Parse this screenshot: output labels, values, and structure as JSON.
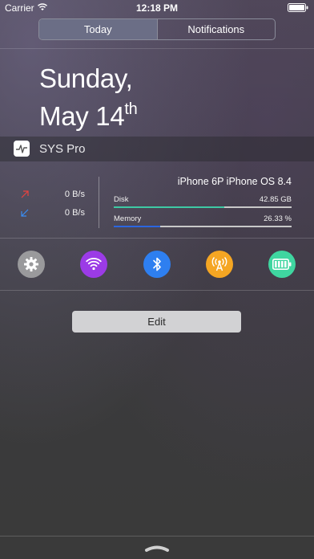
{
  "status_bar": {
    "carrier": "Carrier",
    "time": "12:18 PM"
  },
  "segments": [
    {
      "label": "Today",
      "selected": true
    },
    {
      "label": "Notifications",
      "selected": false
    }
  ],
  "date": {
    "weekday": "Sunday,",
    "month_day": "May 14",
    "suffix": "th"
  },
  "widget": {
    "title": "SYS Pro",
    "icon": "pulse-icon",
    "network": [
      {
        "direction": "upload",
        "icon": "arrow-up-right-icon",
        "color": "#e8433f",
        "value": "0 B/s"
      },
      {
        "direction": "download",
        "icon": "arrow-down-left-icon",
        "color": "#3a8ef5",
        "value": "0 B/s"
      }
    ],
    "device": "iPhone 6P iPhone OS 8.4",
    "disk": {
      "label": "Disk",
      "value": "42.85 GB",
      "fraction": 0.62,
      "color": "#3ec9a4"
    },
    "memory": {
      "label": "Memory",
      "value": "26.33 %",
      "fraction": 0.2633,
      "color": "#2b66e0"
    },
    "toggles": [
      {
        "name": "settings",
        "icon": "gear-icon",
        "color": "#9a9a9c"
      },
      {
        "name": "wifi",
        "icon": "wifi-icon",
        "color": "#9b3be6"
      },
      {
        "name": "bluetooth",
        "icon": "bluetooth-icon",
        "color": "#2e7ff0"
      },
      {
        "name": "cellular",
        "icon": "cellular-tower-icon",
        "color": "#f5a623"
      },
      {
        "name": "battery",
        "icon": "battery-icon",
        "color": "#3fd6a0"
      }
    ]
  },
  "edit_label": "Edit"
}
